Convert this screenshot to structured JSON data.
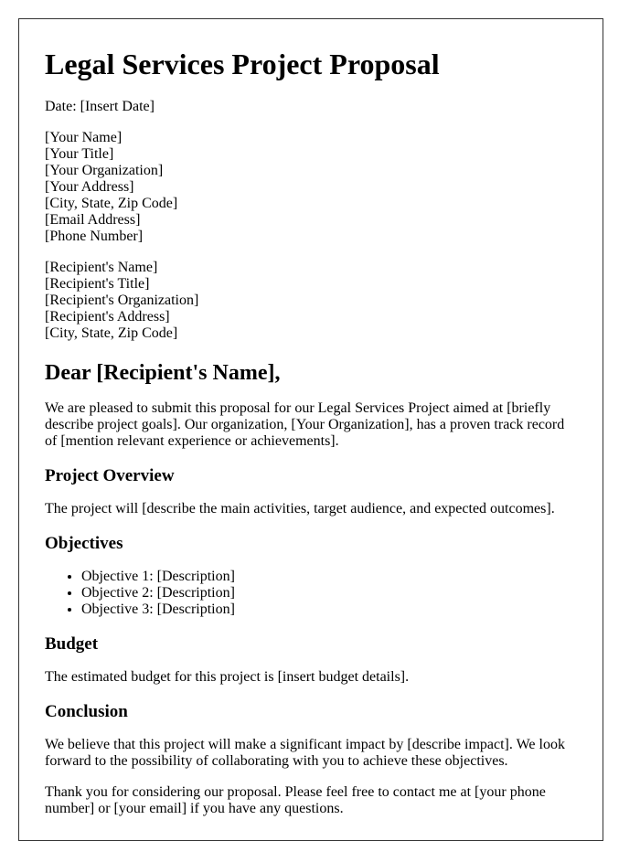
{
  "title": "Legal Services Project Proposal",
  "date_line": "Date: [Insert Date]",
  "sender": [
    "[Your Name]",
    "[Your Title]",
    "[Your Organization]",
    "[Your Address]",
    "[City, State, Zip Code]",
    "[Email Address]",
    "[Phone Number]"
  ],
  "recipient": [
    "[Recipient's Name]",
    "[Recipient's Title]",
    "[Recipient's Organization]",
    "[Recipient's Address]",
    "[City, State, Zip Code]"
  ],
  "salutation": "Dear [Recipient's Name],",
  "intro": "We are pleased to submit this proposal for our Legal Services Project aimed at [briefly describe project goals]. Our organization, [Your Organization], has a proven track record of [mention relevant experience or achievements].",
  "sections": {
    "overview": {
      "heading": "Project Overview",
      "text": "The project will [describe the main activities, target audience, and expected outcomes]."
    },
    "objectives": {
      "heading": "Objectives",
      "items": [
        "Objective 1: [Description]",
        "Objective 2: [Description]",
        "Objective 3: [Description]"
      ]
    },
    "budget": {
      "heading": "Budget",
      "text": "The estimated budget for this project is [insert budget details]."
    },
    "conclusion": {
      "heading": "Conclusion",
      "text": "We believe that this project will make a significant impact by [describe impact]. We look forward to the possibility of collaborating with you to achieve these objectives."
    }
  },
  "closing": "Thank you for considering our proposal. Please feel free to contact me at [your phone number] or [your email] if you have any questions."
}
